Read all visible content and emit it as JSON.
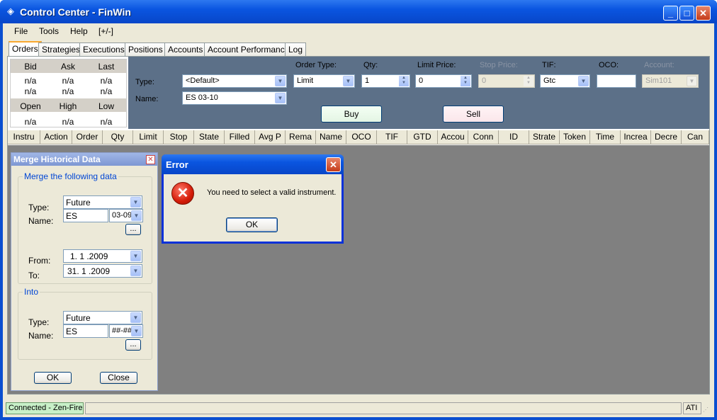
{
  "window": {
    "title": "Control Center - FinWin",
    "minimize": "_",
    "maximize": "□",
    "close": "✕"
  },
  "menu": [
    "File",
    "Tools",
    "Help",
    "[+/-]"
  ],
  "tabs": [
    "Orders",
    "Strategies",
    "Executions",
    "Positions",
    "Accounts",
    "Account Performance",
    "Log"
  ],
  "quote": {
    "headers1": [
      "Bid",
      "Ask",
      "Last"
    ],
    "row1": [
      "n/a",
      "n/a",
      "n/a"
    ],
    "row2": [
      "n/a",
      "n/a",
      "n/a"
    ],
    "headers2": [
      "Open",
      "High",
      "Low"
    ],
    "row3": [
      "n/a",
      "n/a",
      "n/a"
    ]
  },
  "order": {
    "type_label": "Type:",
    "type_value": "<Default>",
    "name_label": "Name:",
    "name_value": "ES 03-10",
    "order_type_label": "Order Type:",
    "order_type_value": "Limit",
    "qty_label": "Qty:",
    "qty_value": "1",
    "limit_label": "Limit Price:",
    "limit_value": "0",
    "stop_label": "Stop Price:",
    "stop_value": "0",
    "tif_label": "TIF:",
    "tif_value": "Gtc",
    "oco_label": "OCO:",
    "oco_value": "",
    "account_label": "Account:",
    "account_value": "Sim101",
    "buy": "Buy",
    "sell": "Sell"
  },
  "columns": [
    "Instru",
    "Action",
    "Order",
    "Qty",
    "Limit",
    "Stop",
    "State",
    "Filled",
    "Avg P",
    "Rema",
    "Name",
    "OCO",
    "TIF",
    "GTD",
    "Accou",
    "Conn",
    "ID",
    "Strate",
    "Token",
    "Time",
    "Increa",
    "Decre",
    "Can"
  ],
  "merge": {
    "title": "Merge Historical Data",
    "group1": "Merge the following data",
    "type_label": "Type:",
    "type_value": "Future",
    "name_label": "Name:",
    "name_value": "ES",
    "expiry_value": "03-09",
    "browse": "...",
    "from_label": "From:",
    "from_value": "1. 1 .2009",
    "to_label": "To:",
    "to_value": "31. 1 .2009",
    "group2": "Into",
    "into_type_value": "Future",
    "into_name_value": "ES",
    "into_expiry_value": "##-##",
    "ok": "OK",
    "close": "Close"
  },
  "error": {
    "title": "Error",
    "message": "You need to select a valid instrument.",
    "ok": "OK"
  },
  "status": {
    "connection": "Connected - Zen-Fire",
    "right": "ATI"
  }
}
